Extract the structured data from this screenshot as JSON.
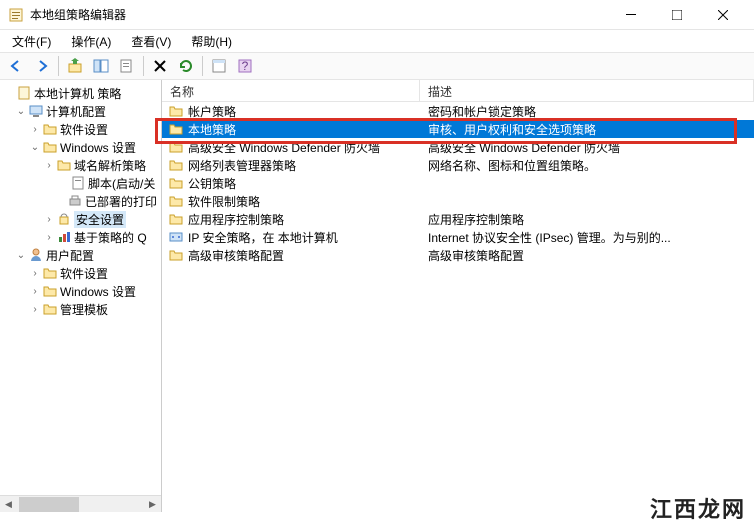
{
  "window": {
    "title": "本地组策略编辑器"
  },
  "menu": {
    "file": "文件(F)",
    "action": "操作(A)",
    "view": "查看(V)",
    "help": "帮助(H)"
  },
  "tree": {
    "root": "本地计算机 策略",
    "computer": "计算机配置",
    "software1": "软件设置",
    "windows_settings": "Windows 设置",
    "dns": "域名解析策略",
    "scripts": "脚本(启动/关",
    "printers": "已部署的打印",
    "security": "安全设置",
    "policy_qos": "基于策略的 Q",
    "user": "用户配置",
    "software2": "软件设置",
    "windows_settings2": "Windows 设置",
    "admin_templates": "管理模板"
  },
  "columns": {
    "name": "名称",
    "desc": "描述"
  },
  "rows": [
    {
      "name": "帐户策略",
      "desc": "密码和帐户锁定策略",
      "icon": "folder"
    },
    {
      "name": "本地策略",
      "desc": "审核、用户权利和安全选项策略",
      "icon": "folder",
      "selected": true
    },
    {
      "name": "高级安全 Windows Defender 防火墙",
      "desc": "高级安全 Windows Defender 防火墙",
      "icon": "folder"
    },
    {
      "name": "网络列表管理器策略",
      "desc": "网络名称、图标和位置组策略。",
      "icon": "folder"
    },
    {
      "name": "公钥策略",
      "desc": "",
      "icon": "folder"
    },
    {
      "name": "软件限制策略",
      "desc": "",
      "icon": "folder"
    },
    {
      "name": "应用程序控制策略",
      "desc": "应用程序控制策略",
      "icon": "folder"
    },
    {
      "name": "IP 安全策略，在 本地计算机",
      "desc": "Internet 协议安全性 (IPsec) 管理。为与别的...",
      "icon": "ip"
    },
    {
      "name": "高级审核策略配置",
      "desc": "高级审核策略配置",
      "icon": "folder"
    }
  ],
  "watermark": "江西龙网"
}
